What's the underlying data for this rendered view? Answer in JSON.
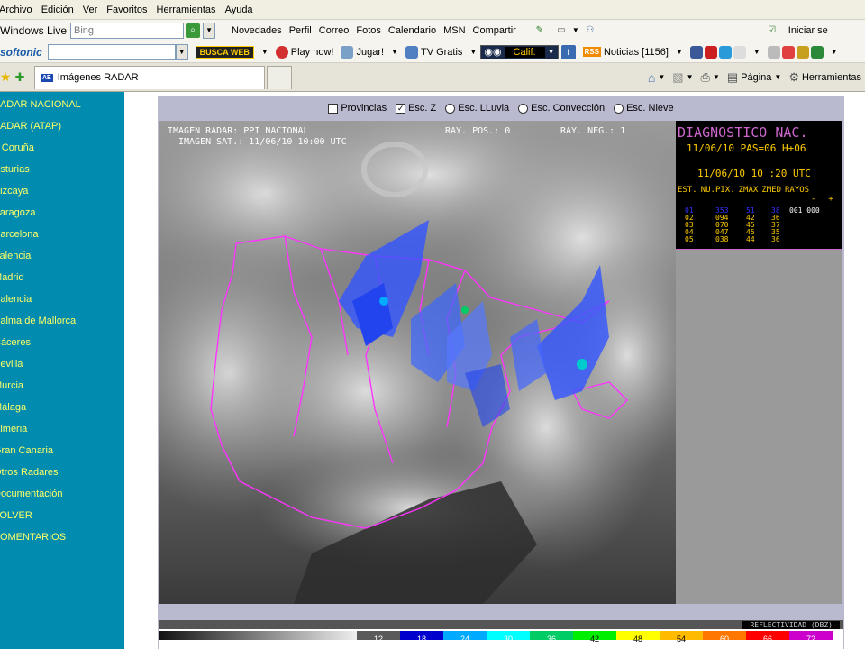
{
  "menu": [
    "Archivo",
    "Edición",
    "Ver",
    "Favoritos",
    "Herramientas",
    "Ayuda"
  ],
  "livebar": {
    "brand": "Windows Live",
    "search_placeholder": "Bing",
    "links": [
      "Novedades",
      "Perfil",
      "Correo",
      "Fotos",
      "Calendario",
      "MSN",
      "Compartir"
    ],
    "signin": "Iniciar se"
  },
  "softbar": {
    "brand": "softonic",
    "buscaweb": "BUSCA WEB",
    "play": "Play now!",
    "jugar": "Jugar!",
    "tv": "TV Gratis",
    "calif": "Calif.",
    "noticias": "Noticias [1156]"
  },
  "tab": {
    "title": "Imágenes RADAR",
    "favicon": "AE",
    "cmd_pagina": "Página",
    "cmd_herramientas": "Herramientas"
  },
  "sidebar": [
    "RADAR NACIONAL",
    "RADAR (ATAP)",
    "A Coruña",
    "Asturias",
    "Vizcaya",
    "Zaragoza",
    "Barcelona",
    "Valencia",
    "Madrid",
    "Palencia",
    "Palma de Mallorca",
    "Cáceres",
    "Sevilla",
    "Murcia",
    "Málaga",
    "Almeria",
    "Gran Canaria",
    "Otros Radares",
    "Documentación",
    "VOLVER",
    "COMENTARIOS"
  ],
  "options": [
    {
      "label": "Provincias",
      "type": "checkbox",
      "checked": false
    },
    {
      "label": "Esc. Z",
      "type": "checkbox",
      "checked": true
    },
    {
      "label": "Esc. LLuvia",
      "type": "radio",
      "checked": false
    },
    {
      "label": "Esc. Convección",
      "type": "radio",
      "checked": false
    },
    {
      "label": "Esc. Nieve",
      "type": "radio",
      "checked": false
    }
  ],
  "radar": {
    "line1": "IMAGEN RADAR: PPI NACIONAL",
    "line2": "IMAGEN SAT.: 11/06/10   10:00 UTC",
    "pos": "RAY. POS.: 0",
    "neg": "RAY. NEG.: 1"
  },
  "diag": {
    "title": "DIAGNOSTICO NAC.",
    "line1": "11/06/10   PAS=06  H+06",
    "line2": "11/06/10   10 :20  UTC",
    "headers": [
      "EST.",
      "NU.PIX.",
      "ZMAX",
      "ZMED",
      "RAYOS"
    ],
    "signs": [
      "-",
      "+"
    ],
    "rows": [
      {
        "est": "01",
        "nupix": "353",
        "zmax": "51",
        "zmed": "38",
        "rayos": "001 000"
      },
      {
        "est": "02",
        "nupix": "094",
        "zmax": "42",
        "zmed": "36",
        "rayos": ""
      },
      {
        "est": "03",
        "nupix": "070",
        "zmax": "45",
        "zmed": "37",
        "rayos": ""
      },
      {
        "est": "04",
        "nupix": "047",
        "zmax": "45",
        "zmed": "35",
        "rayos": ""
      },
      {
        "est": "05",
        "nupix": "038",
        "zmax": "44",
        "zmed": "36",
        "rayos": ""
      }
    ]
  },
  "legend": {
    "values": [
      "12",
      "18",
      "24",
      "30",
      "36",
      "42",
      "48",
      "54",
      "60",
      "66",
      "72"
    ],
    "colors": [
      "#5a5a5a",
      "#0000cc",
      "#00aaff",
      "#00ffff",
      "#00cc66",
      "#00ee00",
      "#ffff00",
      "#ffbb00",
      "#ff7700",
      "#ff0000",
      "#cc00cc"
    ],
    "title": "REFLECTIVIDAD (DBZ)"
  },
  "colors": {
    "sidebar_bg": "#008baf",
    "sidebar_link": "#ffff66",
    "diag_title": "#cc66cc",
    "diag_date": "#ffcc00",
    "diag_row_first": "#3333ff",
    "diag_rows": "#ffcc00"
  }
}
